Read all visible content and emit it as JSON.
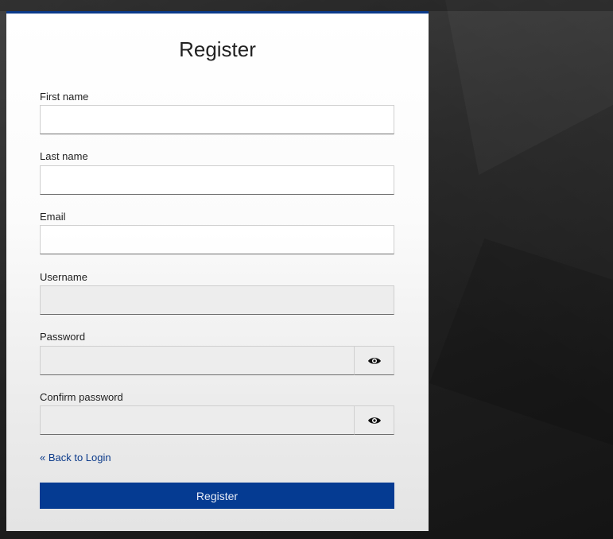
{
  "form": {
    "title": "Register",
    "fields": [
      {
        "label": "First name",
        "value": ""
      },
      {
        "label": "Last name",
        "value": ""
      },
      {
        "label": "Email",
        "value": ""
      },
      {
        "label": "Username",
        "value": ""
      },
      {
        "label": "Password",
        "value": ""
      },
      {
        "label": "Confirm password",
        "value": ""
      }
    ],
    "back_link": "« Back to Login",
    "submit_label": "Register"
  },
  "icons": {
    "password_toggle": "eye-icon",
    "confirm_password_toggle": "eye-icon"
  },
  "colors": {
    "accent": "#053b92",
    "link": "#0b3a8a"
  }
}
